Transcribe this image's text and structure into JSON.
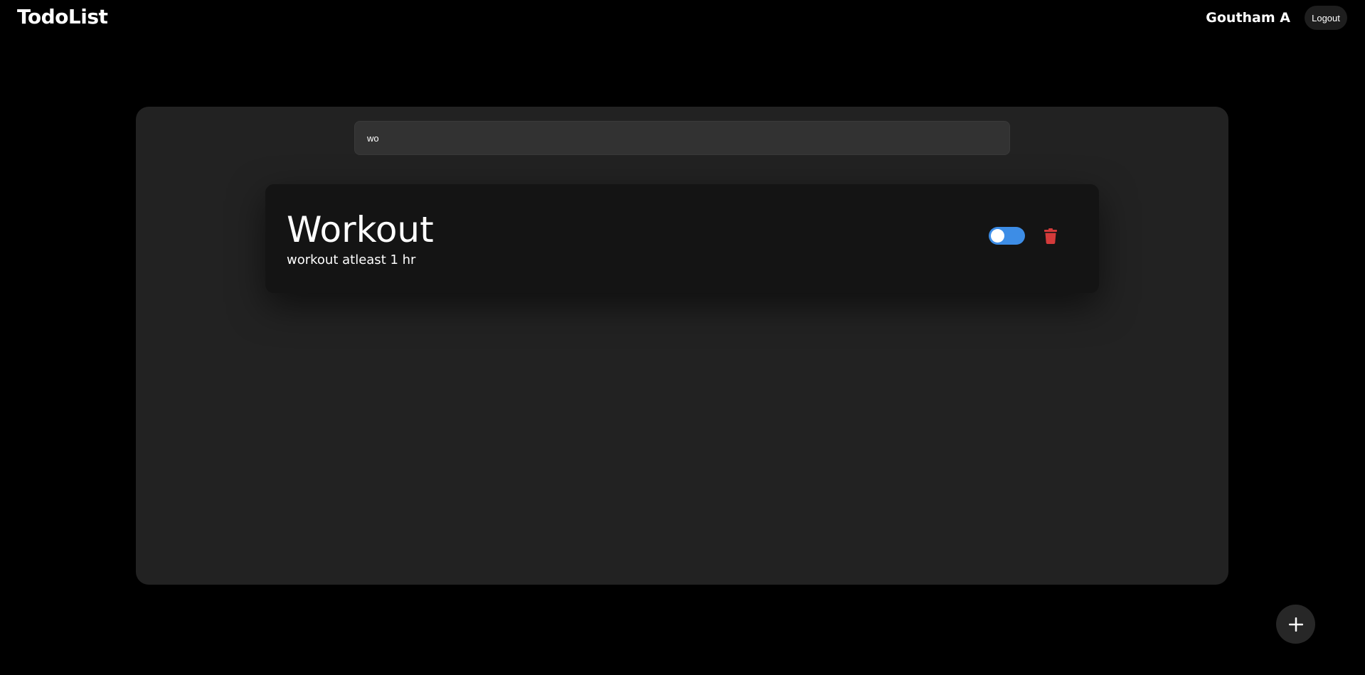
{
  "app": {
    "brand": "TodoList"
  },
  "header": {
    "user_name": "Goutham A",
    "logout_label": "Logout"
  },
  "search": {
    "value": "wo",
    "placeholder": ""
  },
  "tasks": [
    {
      "title": "Workout",
      "description": "workout atleast 1 hr",
      "toggle_on": true,
      "icons": {
        "delete": "trash-icon"
      }
    }
  ],
  "fab": {
    "icon": "plus-icon"
  },
  "colors": {
    "background": "#000000",
    "panel": "#222222",
    "card": "#141414",
    "toggle_accent": "#3d8de6",
    "delete": "#d43a3a"
  }
}
